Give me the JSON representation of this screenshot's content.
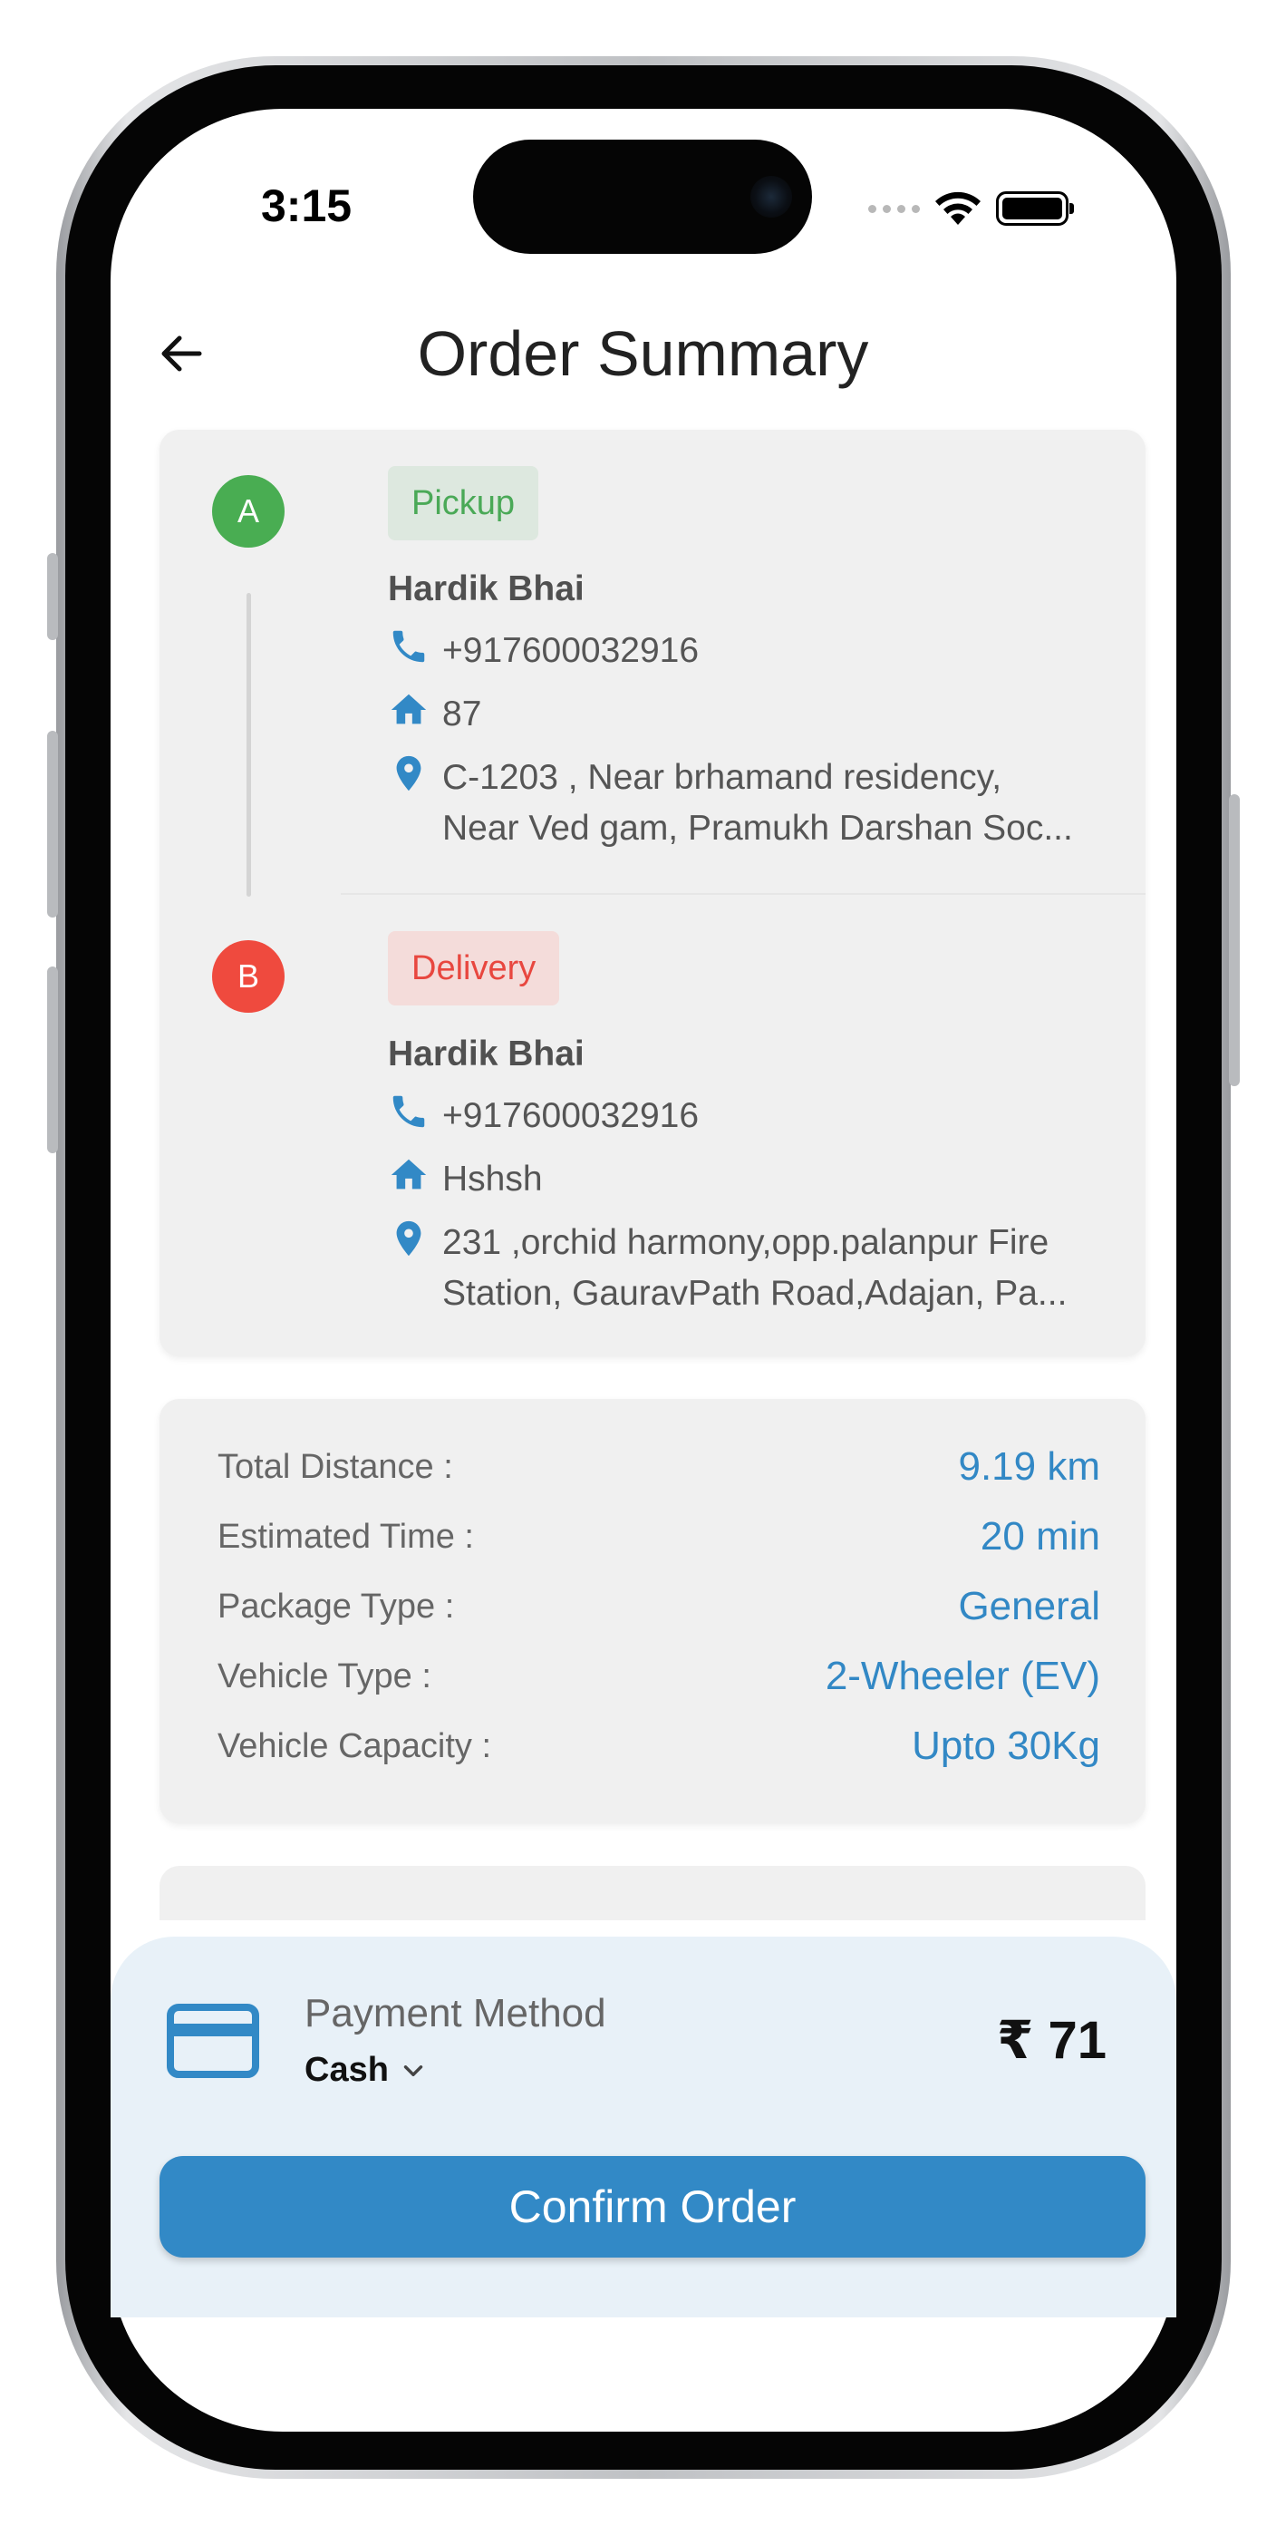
{
  "status_bar": {
    "time": "3:15"
  },
  "header": {
    "title": "Order Summary"
  },
  "pickup": {
    "marker": "A",
    "tag": "Pickup",
    "name": "Hardik Bhai",
    "phone": "+917600032916",
    "house": "87",
    "address_line1": "C-1203 , Near brhamand residency,",
    "address_line2": "Near Ved gam, Pramukh Darshan Soc..."
  },
  "delivery": {
    "marker": "B",
    "tag": "Delivery",
    "name": "Hardik Bhai",
    "phone": "+917600032916",
    "house": "Hshsh",
    "address_line1": "231 ,orchid harmony,opp.palanpur Fire",
    "address_line2": "Station, GauravPath Road,Adajan, Pa..."
  },
  "details": [
    {
      "label": "Total Distance :",
      "value": "9.19 km"
    },
    {
      "label": "Estimated Time :",
      "value": "20 min"
    },
    {
      "label": "Package Type :",
      "value": "General"
    },
    {
      "label": "Vehicle Type :",
      "value": "2-Wheeler (EV)"
    },
    {
      "label": "Vehicle Capacity :",
      "value": "Upto 30Kg"
    }
  ],
  "payment": {
    "label": "Payment Method",
    "selected": "Cash",
    "amount": "₹ 71"
  },
  "confirm_label": "Confirm Order",
  "colors": {
    "accent": "#3289c6",
    "pickup_green": "#49ad52",
    "delivery_red": "#ef4a3e",
    "card_bg": "#f0f0f0",
    "sheet_bg": "#e8f1f8"
  },
  "icons": {
    "back": "arrow-left-icon",
    "phone": "phone-icon",
    "house": "home-icon",
    "location": "location-pin-icon",
    "payment": "credit-card-icon",
    "dropdown": "chevron-down-icon"
  }
}
